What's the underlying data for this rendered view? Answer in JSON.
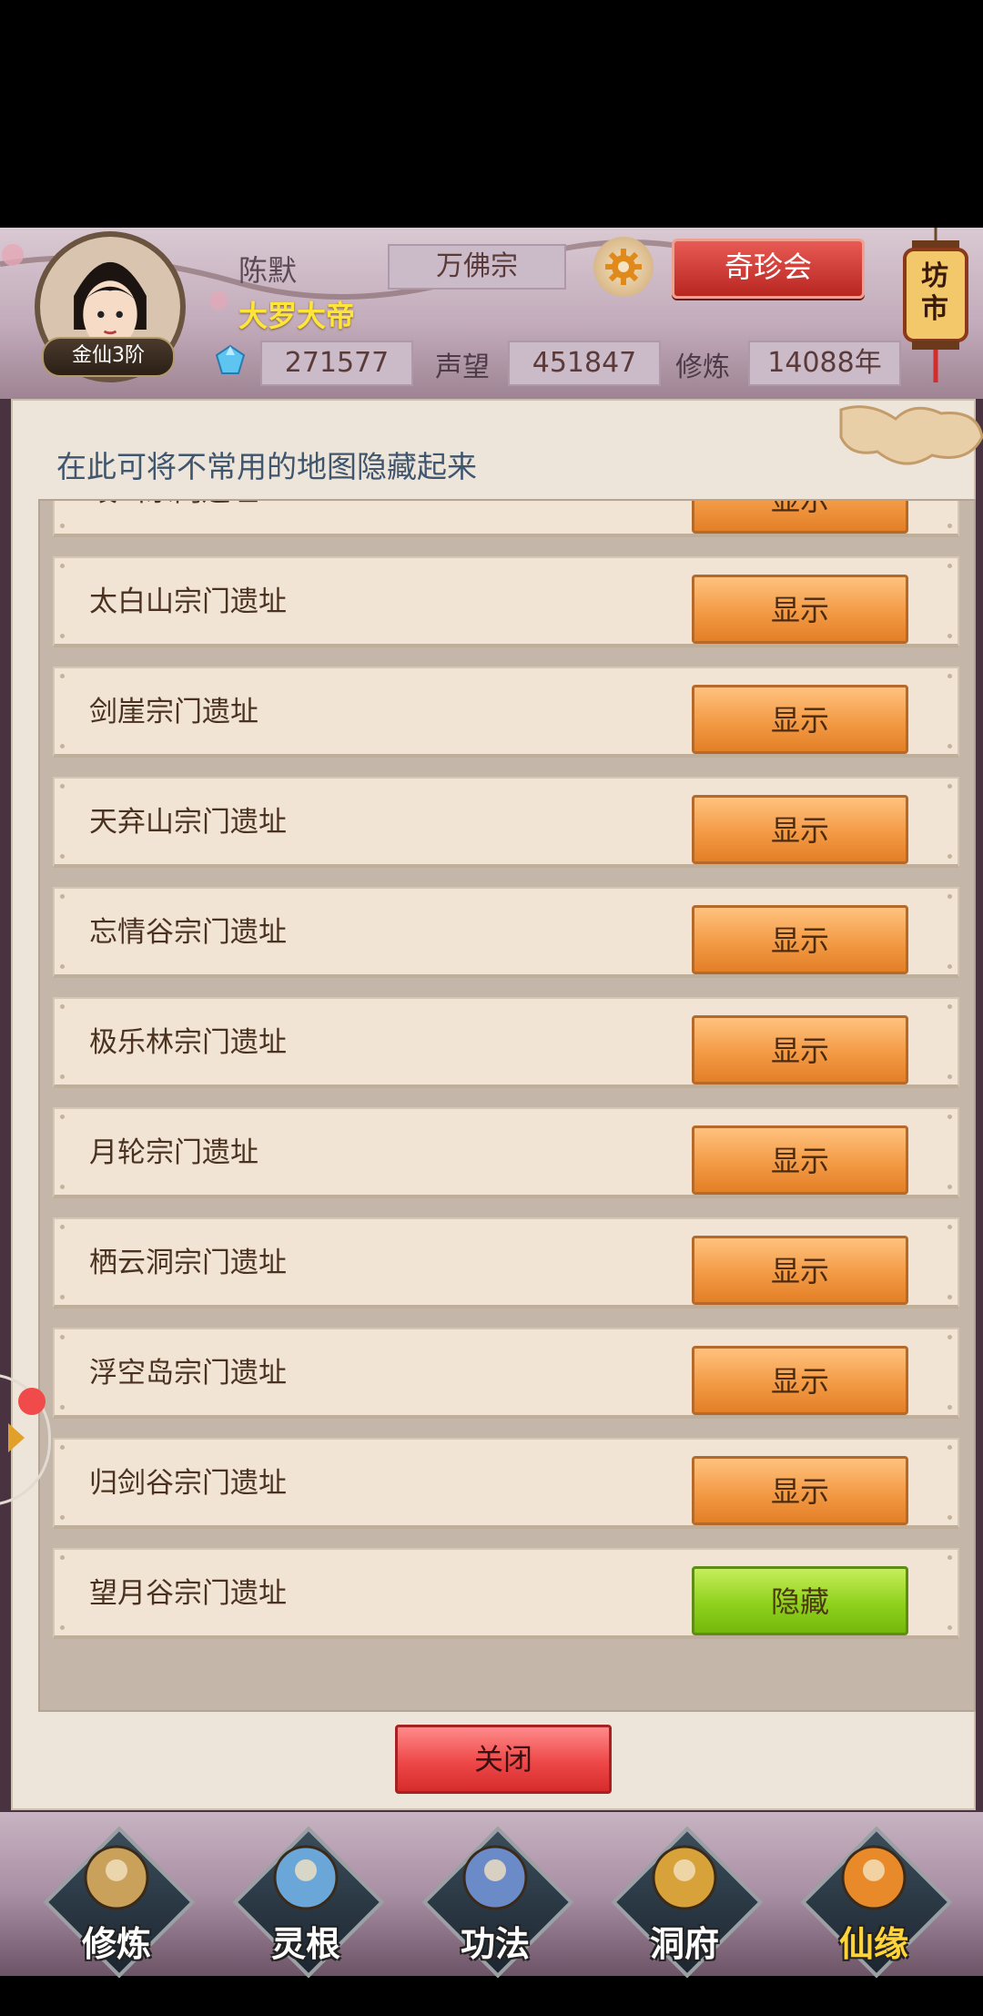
{
  "header": {
    "player_name": "陈默",
    "player_title": "大罗大帝",
    "rank": "金仙3阶",
    "sect": "万佛宗",
    "treasure_button": "奇珍会",
    "market_label": "坊市",
    "stats": {
      "spirit_stones": "271577",
      "reputation_label": "声望",
      "reputation": "451847",
      "cultivation_label": "修炼",
      "cultivation": "14088年"
    }
  },
  "panel": {
    "hint": "在此可将不常用的地图隐藏起来",
    "rows": [
      {
        "name": "岐山宗门遗址",
        "action": "显示",
        "state": "show"
      },
      {
        "name": "太白山宗门遗址",
        "action": "显示",
        "state": "show"
      },
      {
        "name": "剑崖宗门遗址",
        "action": "显示",
        "state": "show"
      },
      {
        "name": "天弃山宗门遗址",
        "action": "显示",
        "state": "show"
      },
      {
        "name": "忘情谷宗门遗址",
        "action": "显示",
        "state": "show"
      },
      {
        "name": "极乐林宗门遗址",
        "action": "显示",
        "state": "show"
      },
      {
        "name": "月轮宗门遗址",
        "action": "显示",
        "state": "show"
      },
      {
        "name": "栖云洞宗门遗址",
        "action": "显示",
        "state": "show"
      },
      {
        "name": "浮空岛宗门遗址",
        "action": "显示",
        "state": "show"
      },
      {
        "name": "归剑谷宗门遗址",
        "action": "显示",
        "state": "show"
      },
      {
        "name": "望月谷宗门遗址",
        "action": "隐藏",
        "state": "hide"
      }
    ],
    "close_button": "关闭"
  },
  "bottom_nav": [
    {
      "label": "修炼",
      "icon": "cultivate-icon"
    },
    {
      "label": "灵根",
      "icon": "spirit-root-icon"
    },
    {
      "label": "功法",
      "icon": "technique-icon"
    },
    {
      "label": "洞府",
      "icon": "cave-icon"
    },
    {
      "label": "仙缘",
      "icon": "fate-icon"
    }
  ],
  "colors": {
    "show_button": "#f39a45",
    "hide_button": "#8fd11d",
    "close_button": "#ee4848",
    "title_yellow": "#ffe43a"
  }
}
